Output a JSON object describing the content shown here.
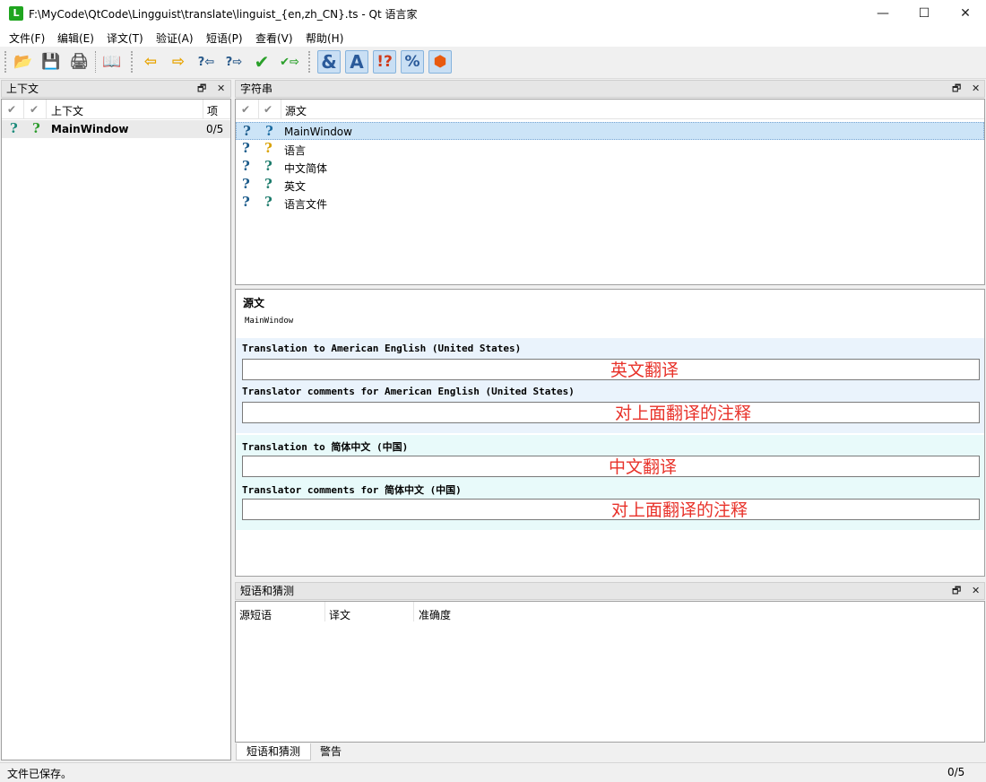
{
  "window": {
    "title": "F:\\MyCode\\QtCode\\Lingguist\\translate\\linguist_{en,zh_CN}.ts - Qt 语言家",
    "app_icon_letter": "L",
    "minimize": "—",
    "maximize": "☐",
    "close": "✕"
  },
  "menu": [
    "文件(F)",
    "编辑(E)",
    "译文(T)",
    "验证(A)",
    "短语(P)",
    "查看(V)",
    "帮助(H)"
  ],
  "toolbar": {
    "open_icon": "📂",
    "save_icon": "💾",
    "print_icon": "🖨",
    "phrasebook_icon": "📖",
    "prev_icon": "⇦",
    "next_icon": "⇨",
    "prev_unfinished_icon": "?⇦",
    "next_unfinished_icon": "?⇨",
    "done_icon": "✔",
    "done_next_icon": "✔⇨",
    "accelerators_icon": "&",
    "punctuation_icon": "A",
    "phrase_match_icon": "!?",
    "placeholders_icon": "%",
    "consistency_icon": "⬢"
  },
  "context_panel": {
    "title": "上下文",
    "float_btn": "🗗",
    "close_btn": "✕",
    "columns": [
      "✔",
      "✔",
      "上下文",
      "项"
    ],
    "rows": [
      {
        "status1": "?",
        "status2": "?",
        "context": "MainWindow",
        "items": "0/5"
      }
    ]
  },
  "strings_panel": {
    "title": "字符串",
    "float_btn": "🗗",
    "close_btn": "✕",
    "columns": [
      "✔",
      "✔",
      "源文"
    ],
    "rows": [
      {
        "status1": "?",
        "status2": "?",
        "source": "MainWindow"
      },
      {
        "status1": "?",
        "status2": "?",
        "source": "语言"
      },
      {
        "status1": "?",
        "status2": "?",
        "source": "中文简体"
      },
      {
        "status1": "?",
        "status2": "?",
        "source": "英文"
      },
      {
        "status1": "?",
        "status2": "?",
        "source": "语言文件"
      }
    ]
  },
  "editor": {
    "source_label": "源文",
    "source_text": "MainWindow",
    "en_translation_label": "Translation to American English (United States)",
    "en_translation_note": "英文翻译",
    "en_comment_label": "Translator comments for American English (United States)",
    "en_comment_note": "对上面翻译的注释",
    "zh_translation_label": "Translation to 简体中文 (中国)",
    "zh_translation_note": "中文翻译",
    "zh_comment_label": "Translator comments for 简体中文 (中国)",
    "zh_comment_note": "对上面翻译的注释"
  },
  "phrases_panel": {
    "title": "短语和猜测",
    "float_btn": "🗗",
    "close_btn": "✕",
    "columns": [
      "源短语",
      "译文",
      "准确度"
    ]
  },
  "bottom_tabs": [
    "短语和猜测",
    "警告"
  ],
  "status": {
    "message": "文件已保存。",
    "count": "0/5"
  }
}
